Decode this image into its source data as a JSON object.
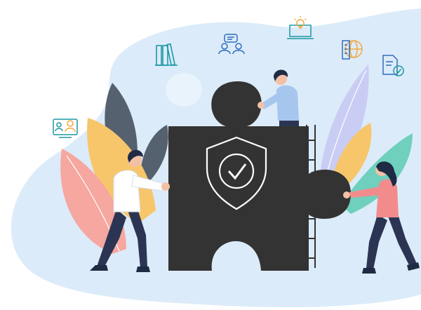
{
  "scene": {
    "subject": "teamwork-puzzle-security-illustration",
    "colors": {
      "background": "#ffffff",
      "blob": "#dcebf9",
      "blob_light": "#e9f3fc",
      "puzzle": "#333333",
      "shield_stroke": "#ffffff",
      "leaf_dark": "#55616e",
      "leaf_yellow": "#f7c66b",
      "leaf_pink": "#f6a79f",
      "leaf_lavender": "#c9cdf4",
      "leaf_teal": "#6fd0bd",
      "icon_teal": "#1b98a3",
      "icon_orange": "#f2a73b",
      "icon_blue": "#2f6dbd",
      "skin": "#f2c1a5",
      "hair": "#1f2a44",
      "pants": "#2b3553",
      "shirt_white": "#ffffff",
      "shirt_blue": "#a6c6ee",
      "shirt_pink": "#f28c8c"
    },
    "icons": [
      "books-icon",
      "chat-people-icon",
      "laptop-lightbulb-icon",
      "globe-building-icon",
      "checked-document-icon",
      "video-call-icon",
      "shield-check-icon"
    ],
    "people": [
      "person-pushing-left",
      "person-sitting-top",
      "person-pushing-right"
    ]
  }
}
